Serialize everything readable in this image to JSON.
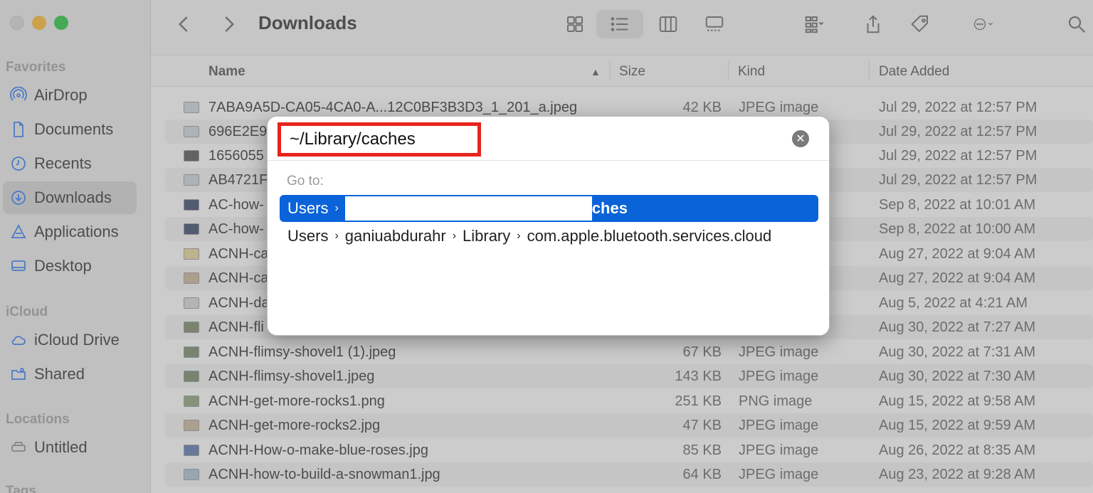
{
  "window": {
    "title": "Downloads"
  },
  "sidebar": {
    "sections": [
      {
        "label": "Favorites",
        "items": [
          {
            "label": "AirDrop",
            "icon": "airdrop-icon"
          },
          {
            "label": "Documents",
            "icon": "document-icon"
          },
          {
            "label": "Recents",
            "icon": "clock-icon"
          },
          {
            "label": "Downloads",
            "icon": "download-icon",
            "selected": true
          },
          {
            "label": "Applications",
            "icon": "applications-icon"
          },
          {
            "label": "Desktop",
            "icon": "desktop-icon"
          }
        ]
      },
      {
        "label": "iCloud",
        "items": [
          {
            "label": "iCloud Drive",
            "icon": "cloud-icon"
          },
          {
            "label": "Shared",
            "icon": "shared-folder-icon"
          }
        ]
      },
      {
        "label": "Locations",
        "items": [
          {
            "label": "Untitled",
            "icon": "drive-icon"
          }
        ]
      },
      {
        "label": "Tags",
        "items": []
      }
    ]
  },
  "columns": {
    "name": "Name",
    "size": "Size",
    "kind": "Kind",
    "date_added": "Date Added"
  },
  "files": [
    {
      "name": "7ABA9A5D-CA05-4CA0-A...12C0BF3B3D3_1_201_a.jpeg",
      "size": "42 KB",
      "kind": "JPEG image",
      "date": "Jul 29, 2022 at 12:57 PM"
    },
    {
      "name": "696E2E9",
      "size": "",
      "kind": "",
      "date": "Jul 29, 2022 at 12:57 PM"
    },
    {
      "name": "1656055",
      "size": "",
      "kind": "",
      "date": "Jul 29, 2022 at 12:57 PM"
    },
    {
      "name": "AB4721F",
      "size": "",
      "kind": "",
      "date": "Jul 29, 2022 at 12:57 PM"
    },
    {
      "name": "AC-how-",
      "size": "",
      "kind": "",
      "date": "Sep 8, 2022 at 10:01 AM"
    },
    {
      "name": "AC-how-",
      "size": "",
      "kind": "",
      "date": "Sep 8, 2022 at 10:00 AM"
    },
    {
      "name": "ACNH-ca",
      "size": "",
      "kind": "",
      "date": "Aug 27, 2022 at 9:04 AM"
    },
    {
      "name": "ACNH-ca",
      "size": "",
      "kind": "",
      "date": "Aug 27, 2022 at 9:04 AM"
    },
    {
      "name": "ACNH-da",
      "size": "",
      "kind": "",
      "date": "Aug 5, 2022 at 4:21 AM"
    },
    {
      "name": "ACNH-fli",
      "size": "",
      "kind": "",
      "date": "Aug 30, 2022 at 7:27 AM"
    },
    {
      "name": "ACNH-flimsy-shovel1 (1).jpeg",
      "size": "67 KB",
      "kind": "JPEG image",
      "date": "Aug 30, 2022 at 7:31 AM"
    },
    {
      "name": "ACNH-flimsy-shovel1.jpeg",
      "size": "143 KB",
      "kind": "JPEG image",
      "date": "Aug 30, 2022 at 7:30 AM"
    },
    {
      "name": "ACNH-get-more-rocks1.png",
      "size": "251 KB",
      "kind": "PNG image",
      "date": "Aug 15, 2022 at 9:58 AM"
    },
    {
      "name": "ACNH-get-more-rocks2.jpg",
      "size": "47 KB",
      "kind": "JPEG image",
      "date": "Aug 15, 2022 at 9:59 AM"
    },
    {
      "name": "ACNH-How-o-make-blue-roses.jpg",
      "size": "85 KB",
      "kind": "JPEG image",
      "date": "Aug 26, 2022 at 8:35 AM"
    },
    {
      "name": "ACNH-how-to-build-a-snowman1.jpg",
      "size": "64 KB",
      "kind": "JPEG image",
      "date": "Aug 23, 2022 at 9:28 AM"
    }
  ],
  "dialog": {
    "path_value": "~/Library/caches",
    "goto_label": "Go to:",
    "suggestion_selected": {
      "segment1": "Users",
      "tail": "ches"
    },
    "suggestion_2": {
      "segment1": "Users",
      "segment2": "ganiuabdurahr",
      "segment3": "Library",
      "segment4": "com.apple.bluetooth.services.cloud"
    }
  }
}
